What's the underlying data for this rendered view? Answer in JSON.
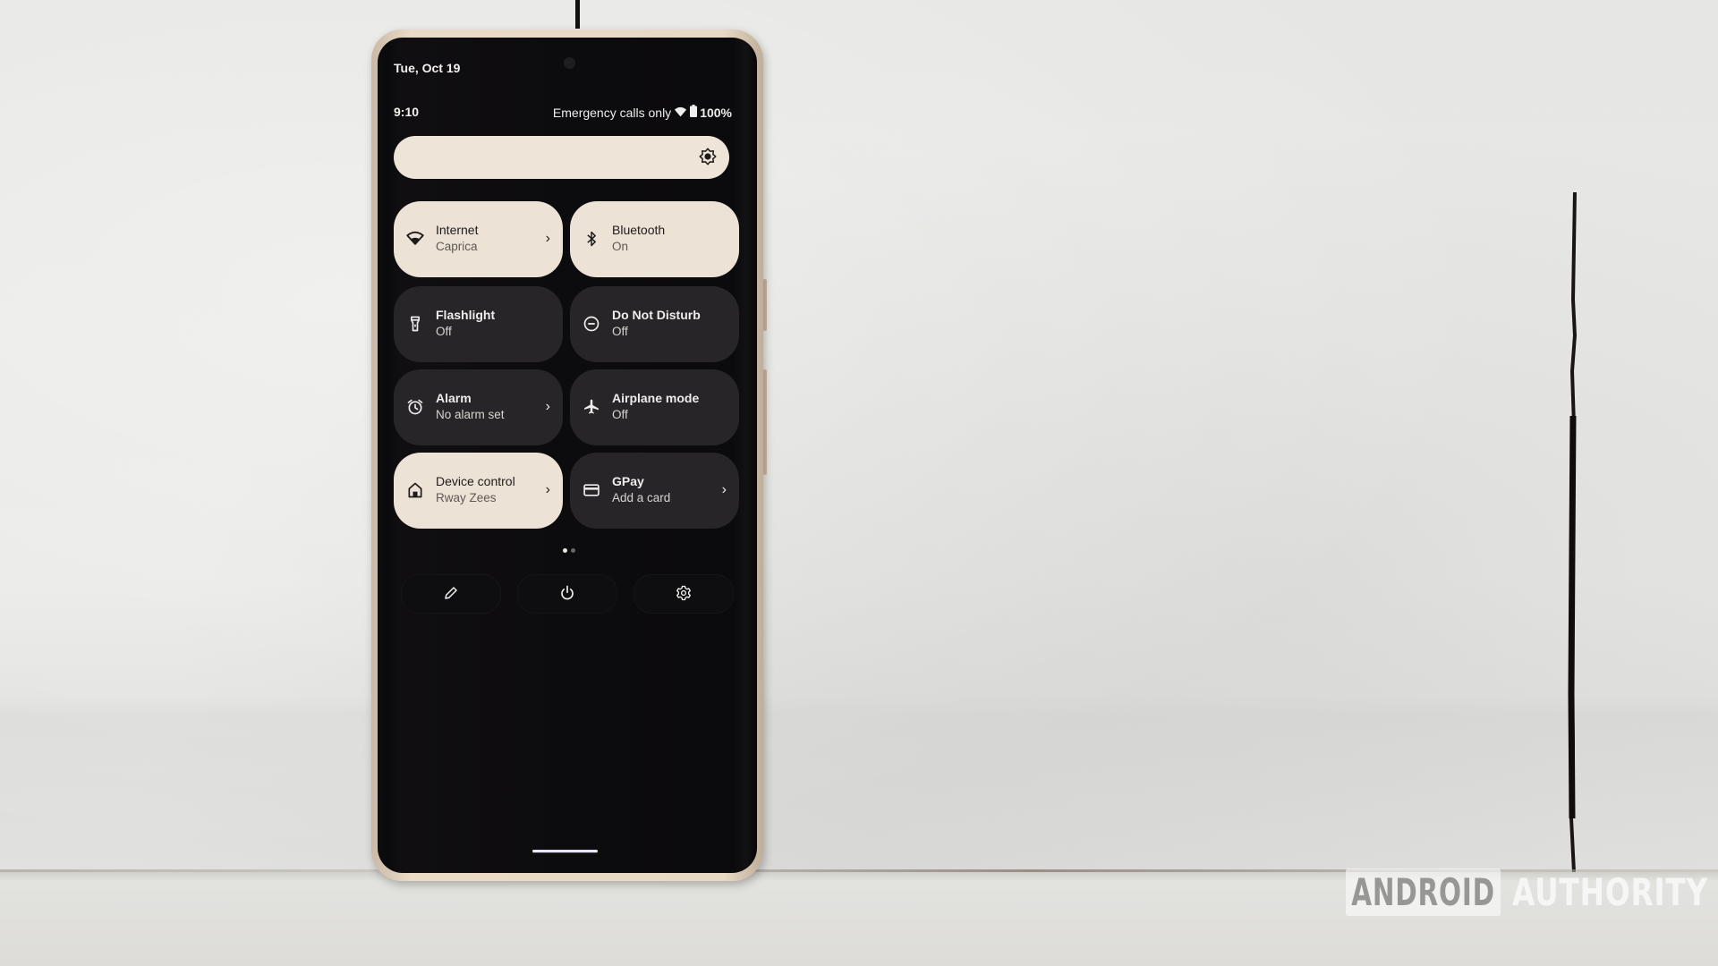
{
  "watermark": {
    "part1": "ANDROID",
    "part2": "AUTHORITY"
  },
  "status_bar": {
    "date": "Tue, Oct 19",
    "time": "9:10",
    "carrier_text": "Emergency calls only",
    "wifi_icon": "wifi-icon",
    "battery_icon": "battery-icon",
    "battery_percent": "100%"
  },
  "brightness": {
    "icon": "brightness-icon",
    "level_fraction": 1.0
  },
  "tiles": [
    {
      "title": "Internet",
      "subtitle": "Caprica",
      "icon": "wifi-icon",
      "state": "on",
      "has_chevron": true
    },
    {
      "title": "Bluetooth",
      "subtitle": "On",
      "icon": "bluetooth-icon",
      "state": "on",
      "has_chevron": false
    },
    {
      "title": "Flashlight",
      "subtitle": "Off",
      "icon": "flashlight-icon",
      "state": "off",
      "has_chevron": false
    },
    {
      "title": "Do Not Disturb",
      "subtitle": "Off",
      "icon": "do-not-disturb-icon",
      "state": "off",
      "has_chevron": false
    },
    {
      "title": "Alarm",
      "subtitle": "No alarm set",
      "icon": "alarm-icon",
      "state": "off",
      "has_chevron": true
    },
    {
      "title": "Airplane mode",
      "subtitle": "Off",
      "icon": "airplane-icon",
      "state": "off",
      "has_chevron": false
    },
    {
      "title": "Device control",
      "subtitle": "Rway Zees",
      "icon": "home-icon",
      "state": "on",
      "has_chevron": true
    },
    {
      "title": "GPay",
      "subtitle": "Add a card",
      "icon": "card-icon",
      "state": "off",
      "has_chevron": true
    }
  ],
  "chevron": "›",
  "pager": {
    "current_page": 1,
    "total_pages": 2
  },
  "bottom_buttons": [
    {
      "name": "edit",
      "icon": "pencil-icon"
    },
    {
      "name": "power",
      "icon": "power-icon"
    },
    {
      "name": "settings",
      "icon": "gear-icon"
    }
  ],
  "colors": {
    "tile_on": "#ede2d6",
    "tile_off": "#272527",
    "slider": "#efe4d8",
    "screen_bg": "#0b0a0c"
  }
}
